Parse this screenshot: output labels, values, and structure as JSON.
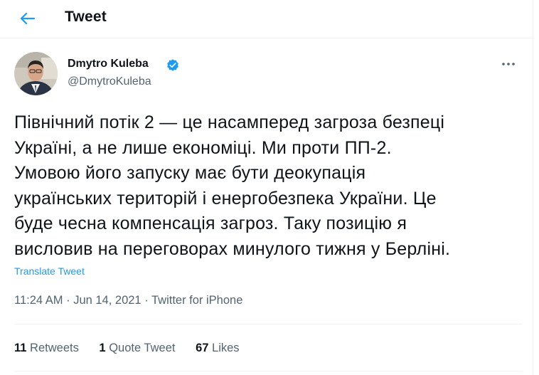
{
  "header": {
    "title": "Tweet",
    "back_icon": "arrow-left-icon"
  },
  "author": {
    "name": "Dmytro Kuleba",
    "handle": "@DmytroKuleba",
    "verified_icon": "verified-badge-icon"
  },
  "tweet": {
    "lines": [
      "Північний потік 2 — це насамперед загроза безпеці",
      "Україні, а не лише економіці. Ми проти ПП-2.",
      "Умовою його запуску має бути деокупація",
      "українських територій і енергобезпека України. Це",
      "буде чесна компенсація загроз. Таку позицію я",
      "висловив на переговорах минулого тижня у Берліні."
    ],
    "translate_label": "Translate Tweet"
  },
  "meta": {
    "time": "11:24 AM",
    "separator": "·",
    "date": "Jun 14, 2021",
    "source": "Twitter for iPhone"
  },
  "stats": {
    "retweets_count": "11",
    "retweets_label": "Retweets",
    "quotes_count": "1",
    "quotes_label": "Quote Tweet",
    "likes_count": "67",
    "likes_label": "Likes"
  },
  "colors": {
    "accent": "#1d9bf0",
    "text": "#0f1419",
    "secondary": "#536471",
    "border": "#eff3f4"
  }
}
